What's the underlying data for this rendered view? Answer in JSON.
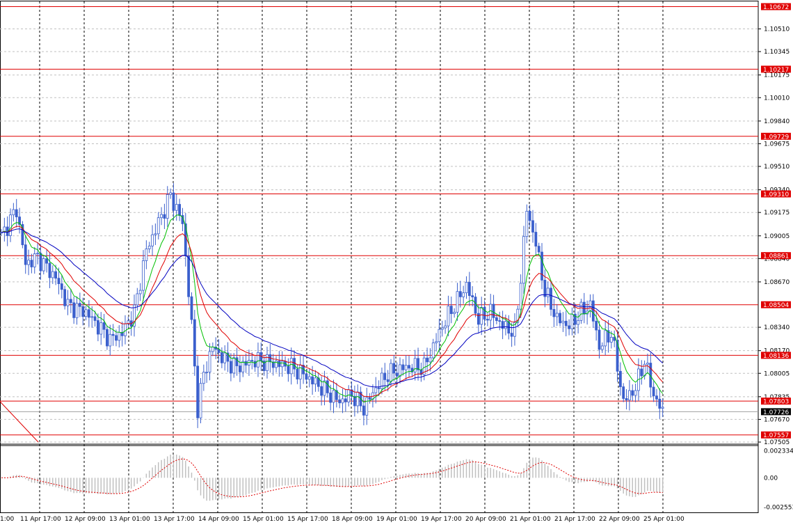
{
  "chart_data": {
    "type": "line",
    "subtype": "candlestick-with-moving-averages-and-macd",
    "colors": {
      "background": "#ffffff",
      "grid": "#c0c0c0",
      "candle": "#3a5fcd",
      "level_line": "#e00000",
      "level_label_bg": "#e00000",
      "level_label_text": "#ffffff",
      "current_label_bg": "#000000",
      "ma_fast": "#00c000",
      "ma_mid": "#e00000",
      "ma_slow": "#0000c0",
      "macd_hist": "#c0c0c0",
      "macd_signal": "#e00000",
      "separator": "#000000"
    },
    "ylim": [
      1.075,
      1.107
    ],
    "y_ticks": [
      "1.10510",
      "1.10345",
      "1.10175",
      "1.10010",
      "1.09840",
      "1.09675",
      "1.09510",
      "1.09340",
      "1.09175",
      "1.09005",
      "1.08840",
      "1.08670",
      "1.08340",
      "1.08170",
      "1.08005",
      "1.07835",
      "1.07670",
      "1.07505"
    ],
    "levels": [
      {
        "label": "1.10672",
        "value": 1.10672
      },
      {
        "label": "1.10217",
        "value": 1.10217
      },
      {
        "label": "1.09729",
        "value": 1.09729
      },
      {
        "label": "1.09310",
        "value": 1.0931
      },
      {
        "label": "1.08861",
        "value": 1.08861
      },
      {
        "label": "1.08504",
        "value": 1.08504
      },
      {
        "label": "1.08136",
        "value": 1.08136
      },
      {
        "label": "1.07803",
        "value": 1.07803
      },
      {
        "label": "1.07557",
        "value": 1.07557
      }
    ],
    "current_price": {
      "label": "1.07726",
      "value": 1.07726
    },
    "x_labels": [
      "1:00",
      "11 Apr 17:00",
      "12 Apr 09:00",
      "13 Apr 01:00",
      "13 Apr 17:00",
      "14 Apr 09:00",
      "15 Apr 01:00",
      "15 Apr 17:00",
      "18 Apr 09:00",
      "19 Apr 01:00",
      "19 Apr 17:00",
      "20 Apr 09:00",
      "21 Apr 01:00",
      "21 Apr 17:00",
      "22 Apr 09:00",
      "25 Apr 01:00"
    ],
    "candle_count": 156,
    "price_anchors": [
      [
        0,
        1.09
      ],
      [
        5,
        1.092
      ],
      [
        8,
        1.088
      ],
      [
        12,
        1.0885
      ],
      [
        18,
        1.087
      ],
      [
        22,
        1.085
      ],
      [
        28,
        1.0845
      ],
      [
        32,
        1.0835
      ],
      [
        36,
        1.0825
      ],
      [
        40,
        1.083
      ],
      [
        44,
        1.0845
      ],
      [
        48,
        1.089
      ],
      [
        52,
        1.091
      ],
      [
        56,
        1.093
      ],
      [
        60,
        1.091
      ],
      [
        63,
        1.0835
      ],
      [
        65,
        1.0775
      ],
      [
        67,
        1.08
      ],
      [
        70,
        1.082
      ],
      [
        74,
        1.081
      ],
      [
        78,
        1.0805
      ],
      [
        84,
        1.081
      ],
      [
        90,
        1.0808
      ],
      [
        96,
        1.0805
      ],
      [
        100,
        1.08
      ],
      [
        106,
        1.079
      ],
      [
        112,
        1.078
      ],
      [
        116,
        1.0785
      ],
      [
        120,
        1.0775
      ],
      [
        124,
        1.079
      ],
      [
        128,
        1.08
      ],
      [
        134,
        1.0805
      ],
      [
        140,
        1.0805
      ],
      [
        146,
        1.0835
      ],
      [
        150,
        1.085
      ],
      [
        154,
        1.0865
      ],
      [
        158,
        1.084
      ],
      [
        162,
        1.0845
      ],
      [
        166,
        1.0835
      ],
      [
        170,
        1.083
      ],
      [
        172,
        1.087
      ],
      [
        174,
        1.092
      ],
      [
        177,
        1.0895
      ],
      [
        180,
        1.086
      ],
      [
        184,
        1.084
      ],
      [
        188,
        1.0835
      ],
      [
        192,
        1.0845
      ],
      [
        195,
        1.085
      ],
      [
        198,
        1.082
      ],
      [
        202,
        1.083
      ],
      [
        206,
        1.078
      ],
      [
        210,
        1.079
      ],
      [
        213,
        1.081
      ],
      [
        216,
        1.0785
      ],
      [
        219,
        1.0772
      ]
    ],
    "ma_periods": {
      "fast": 8,
      "mid": 16,
      "slow": 32
    },
    "macd_ticks": [
      "0.002334",
      "0.00",
      "-0.002553"
    ],
    "macd_ylim": [
      -0.003,
      0.0028
    ]
  }
}
